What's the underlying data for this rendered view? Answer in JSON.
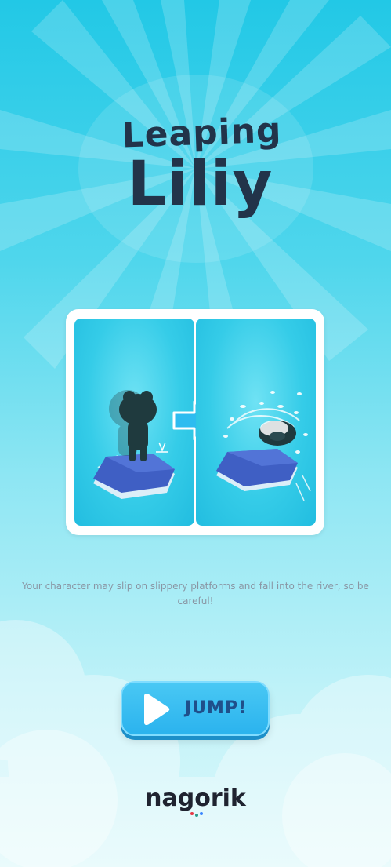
{
  "game": {
    "title_line1": "Leaping",
    "title_line2": "Liliy"
  },
  "tutorial": {
    "description": "Your character may slip on slippery platforms and fall into the river, so be careful!"
  },
  "actions": {
    "jump_label": "JUMP!"
  },
  "brand": {
    "name": "nagorik"
  },
  "colors": {
    "title_text": "#22344a",
    "button_fill": "#2bb3ee",
    "button_label": "#1f4f8a",
    "description_text": "#8a96a4",
    "platform": "#3f5fc4"
  }
}
